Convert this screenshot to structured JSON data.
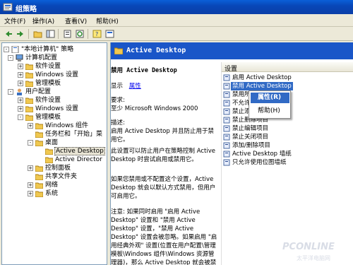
{
  "window": {
    "title": "组策略"
  },
  "menu": [
    "文件(F)",
    "操作(A)",
    "查看(V)",
    "帮助(H)"
  ],
  "toolbar": {
    "icons": [
      "back-icon",
      "forward-icon",
      "up-folder-icon",
      "show-tree-icon",
      "properties-icon",
      "refresh-icon",
      "export-list-icon",
      "help-icon",
      "view-icon"
    ]
  },
  "tree": {
    "items": [
      {
        "label": "\"本地计算机\" 策略",
        "icon": "policy-icon",
        "expander": "-"
      },
      {
        "label": "计算机配置",
        "icon": "computer-icon",
        "expander": "-"
      },
      {
        "label": "软件设置",
        "icon": "folder-icon",
        "expander": "+"
      },
      {
        "label": "Windows 设置",
        "icon": "folder-icon",
        "expander": "+"
      },
      {
        "label": "管理模板",
        "icon": "folder-icon",
        "expander": "+"
      },
      {
        "label": "用户配置",
        "icon": "user-icon",
        "expander": "-"
      },
      {
        "label": "软件设置",
        "icon": "folder-icon",
        "expander": "+"
      },
      {
        "label": "Windows 设置",
        "icon": "folder-icon",
        "expander": "+"
      },
      {
        "label": "管理模板",
        "icon": "folder-icon",
        "expander": "-"
      },
      {
        "label": "Windows 组件",
        "icon": "folder-icon",
        "expander": "+"
      },
      {
        "label": "任务栏和「开始」菜",
        "icon": "folder-icon",
        "expander": ""
      },
      {
        "label": "桌面",
        "icon": "folder-icon",
        "expander": "-"
      },
      {
        "label": "Active Desktop",
        "icon": "folder-open-icon",
        "expander": ""
      },
      {
        "label": "Active Director",
        "icon": "folder-icon",
        "expander": ""
      },
      {
        "label": "控制面板",
        "icon": "folder-icon",
        "expander": "+"
      },
      {
        "label": "共享文件夹",
        "icon": "folder-icon",
        "expander": ""
      },
      {
        "label": "网络",
        "icon": "folder-icon",
        "expander": "+"
      },
      {
        "label": "系统",
        "icon": "folder-icon",
        "expander": "+"
      }
    ]
  },
  "right": {
    "header": "Active Desktop",
    "setting_title": "禁用 Active Desktop",
    "show_label": "显示",
    "properties_link": "属性",
    "requirements": "要求:\n至少 Microsoft Windows 2000",
    "description_label": "描述:",
    "description": "启用 Active Desktop 并且防止用于禁用它。",
    "para1": "此设置可以防止用户在策略控制 Active Desktop 时尝试启用或禁用它。",
    "para2": "如果您禁用或不配置这个设置，Active Desktop 就会以默认方式禁用，但用户可启用它。",
    "para3": "注意: 如果同时启用 \"启用 Active Desktop\" 设置和 \"禁用 Active Desktop\" 设置，\"禁用 Active Desktop\" 设置会被忽略。如果启用 \"启用经典外观\" 设置(位置在用户配置\\管理模板\\Windows 组件\\Windows 资源管理器)，那么 Active Desktop 就会被禁用，并且这两个设置都会被"
  },
  "settings": {
    "column": "设置",
    "rows": [
      {
        "label": "启用 Active Desktop"
      },
      {
        "label": "禁用 Active Desktop"
      },
      {
        "label": "禁用所"
      },
      {
        "label": "不允许"
      },
      {
        "label": "禁止添"
      },
      {
        "label": "禁止删除项目"
      },
      {
        "label": "禁止编辑项目"
      },
      {
        "label": "禁止关闭项目"
      },
      {
        "label": "添加/删除项目"
      },
      {
        "label": "Active Desktop 墙纸"
      },
      {
        "label": "只允许使用位图墙纸"
      }
    ]
  },
  "context_menu": {
    "items": [
      "属性(R)",
      "帮助(H)"
    ]
  },
  "watermark": {
    "brand": "PCONLINE",
    "sub": "太平洋电脑网"
  },
  "colors": {
    "title_bar": "#0a47b8",
    "header_blue": "#1a56c8",
    "selection": "#316ac5"
  }
}
